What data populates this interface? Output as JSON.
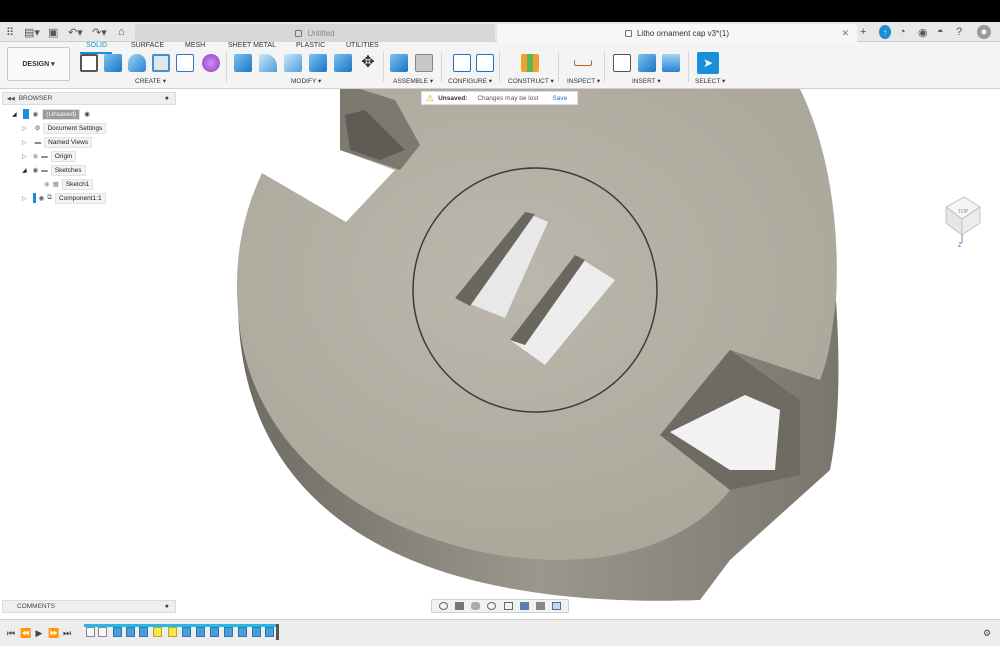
{
  "window": {
    "tabs": [
      {
        "label": "Untitled",
        "active": false
      },
      {
        "label": "Litho ornament cap v3*(1)",
        "active": true
      }
    ]
  },
  "ribbon": {
    "workspace_label": "DESIGN ▾",
    "tabs": [
      "SOLID",
      "SURFACE",
      "MESH",
      "SHEET METAL",
      "PLASTIC",
      "UTILITIES"
    ],
    "active_tab": "SOLID",
    "groups": [
      "CREATE ▾",
      "MODIFY ▾",
      "ASSEMBLE ▾",
      "CONFIGURE ▾",
      "CONSTRUCT ▾",
      "INSPECT ▾",
      "INSERT ▾",
      "SELECT ▾"
    ],
    "accent": "#1a8fd8"
  },
  "banner": {
    "title": "Unsaved:",
    "message": "Changes may be lost",
    "action": "Save"
  },
  "browser": {
    "title": "BROWSER",
    "items": [
      {
        "label": "(Unsaved)",
        "level": 0
      },
      {
        "label": "Document Settings",
        "level": 1
      },
      {
        "label": "Named Views",
        "level": 1
      },
      {
        "label": "Origin",
        "level": 1
      },
      {
        "label": "Sketches",
        "level": 1
      },
      {
        "label": "Sketch1",
        "level": 2
      },
      {
        "label": "Component1:1",
        "level": 1
      }
    ]
  },
  "comments": {
    "title": "COMMENTS"
  },
  "viewcube": {
    "face_label": "TOP",
    "axis_label": "Z"
  }
}
